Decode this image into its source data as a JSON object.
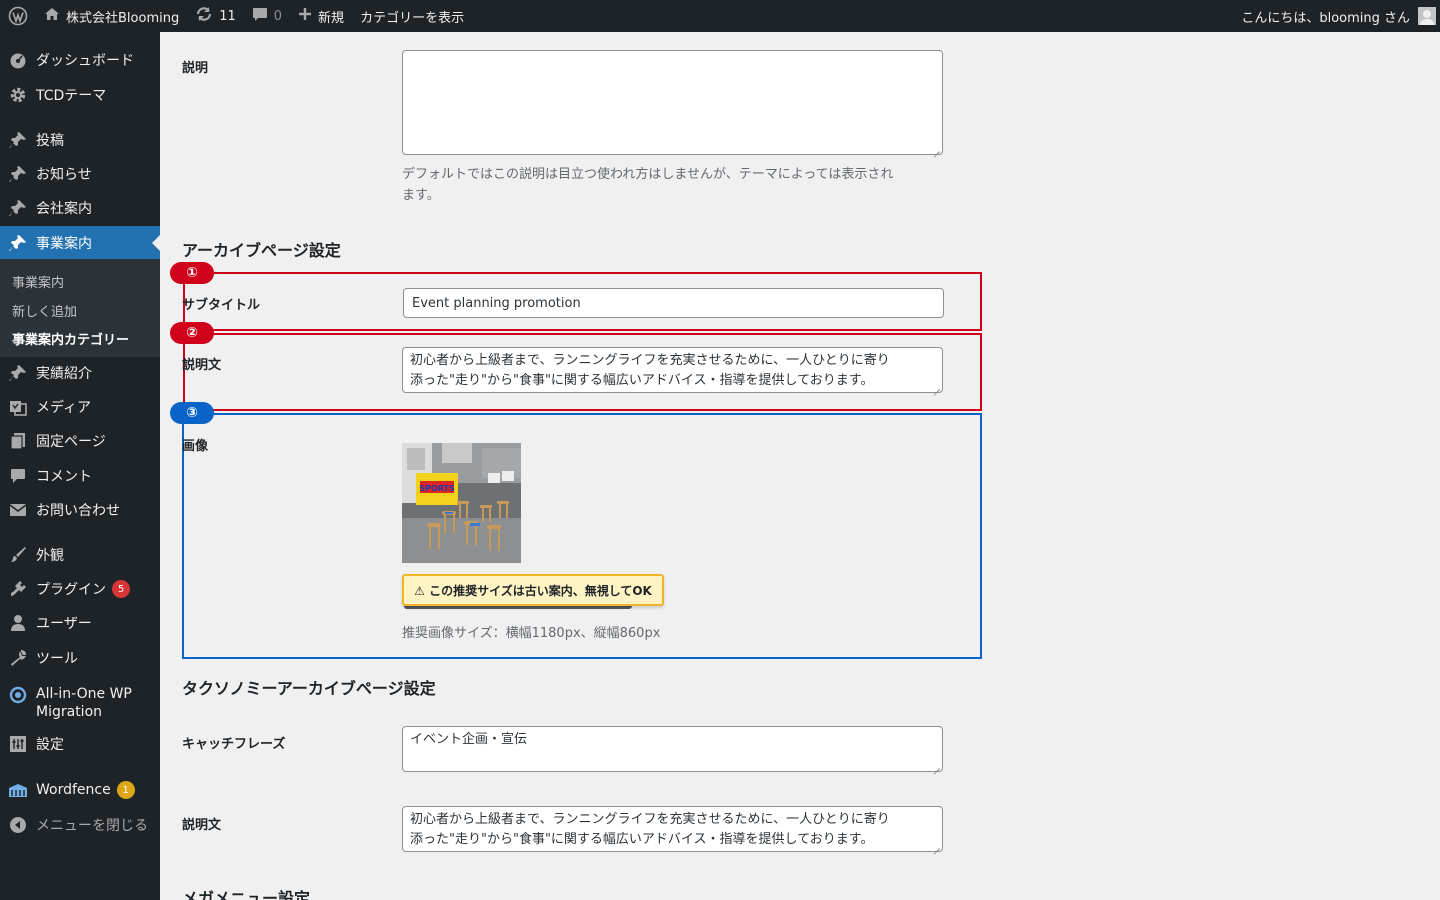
{
  "adminbar": {
    "site_name": "株式会社Blooming",
    "updates_count": "11",
    "comments_count": "0",
    "new_label": "新規",
    "view_category_label": "カテゴリーを表示",
    "greeting": "こんにちは、blooming さん"
  },
  "sidebar": {
    "items": [
      {
        "label": "ダッシュボード",
        "icon": "dashboard-icon"
      },
      {
        "label": "TCDテーマ",
        "icon": "gear-icon"
      },
      {
        "label": "投稿",
        "icon": "pin-icon"
      },
      {
        "label": "お知らせ",
        "icon": "pin-icon"
      },
      {
        "label": "会社案内",
        "icon": "pin-icon"
      },
      {
        "label": "事業案内",
        "icon": "pin-icon",
        "current": true
      },
      {
        "label": "実績紹介",
        "icon": "pin-icon"
      },
      {
        "label": "メディア",
        "icon": "media-icon"
      },
      {
        "label": "固定ページ",
        "icon": "page-icon"
      },
      {
        "label": "コメント",
        "icon": "comment-icon"
      },
      {
        "label": "お問い合わせ",
        "icon": "mail-icon"
      },
      {
        "label": "外観",
        "icon": "brush-icon"
      },
      {
        "label": "プラグイン",
        "icon": "plugin-icon",
        "badge": "5"
      },
      {
        "label": "ユーザー",
        "icon": "user-icon"
      },
      {
        "label": "ツール",
        "icon": "wrench-icon"
      },
      {
        "label": "All-in-One WP Migration",
        "icon": "migration-icon"
      },
      {
        "label": "設定",
        "icon": "settings-icon"
      },
      {
        "label": "Wordfence",
        "icon": "wordfence-icon",
        "badge": "1"
      },
      {
        "label": "メニューを閉じる",
        "icon": "collapse-icon"
      }
    ],
    "submenu": [
      {
        "label": "事業案内"
      },
      {
        "label": "新しく追加"
      },
      {
        "label": "事業案内カテゴリー",
        "current": true
      }
    ]
  },
  "form": {
    "description_label": "説明",
    "description_value": "",
    "description_help_1": "デフォルトではこの説明は目立つ使われ方はしませんが、テーマによっては表示され",
    "description_help_2": "ます。",
    "archive_section_title": "アーカイブページ設定",
    "subtitle_label": "サブタイトル",
    "subtitle_value": "Event planning promotion",
    "archive_desc_label": "説明文",
    "archive_desc_line1": "初心者から上級者まで、ランニングライフを充実させるために、一人ひとりに寄り",
    "archive_desc_line2": "添った\"走り\"から\"食事\"に関する幅広いアドバイス・指導を提供しております。",
    "image_label": "画像",
    "image_hint": "推奨画像サイズ：横幅1180px、縦幅860px",
    "callout_text": "⚠ この推奨サイズは古い案内、無視してOK",
    "photo_sign_text": "SPORTS",
    "taxonomy_section_title": "タクソノミーアーカイブページ設定",
    "catch_label": "キャッチフレーズ",
    "catch_value": "イベント企画・宣伝",
    "tax_desc_label": "説明文",
    "tax_desc_line1": "初心者から上級者まで、ランニングライフを充実させるために、一人ひとりに寄り",
    "tax_desc_line2": "添った\"走り\"から\"食事\"に関する幅広いアドバイス・指導を提供しております。",
    "mega_section_title": "メガメニュー設定"
  },
  "annotations": {
    "marker_1": "①",
    "marker_2": "②",
    "marker_3": "③",
    "red": "#d0021b",
    "blue": "#0a64c8"
  }
}
